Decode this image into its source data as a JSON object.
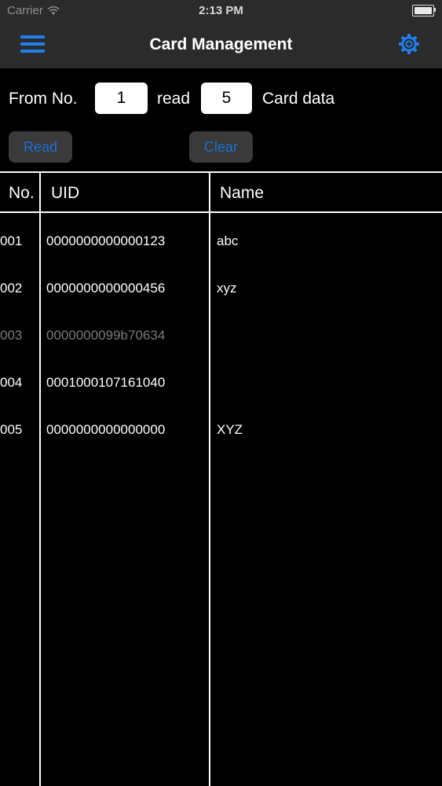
{
  "status_bar": {
    "carrier": "Carrier",
    "time": "2:13 PM",
    "icons": [
      "wifi-icon",
      "battery-icon"
    ]
  },
  "nav": {
    "title": "Card Management",
    "menu_icon": "hamburger-menu-icon",
    "settings_icon": "gear-icon"
  },
  "form": {
    "from_label": "From No.",
    "from_value": "1",
    "read_label": "read",
    "count_value": "5",
    "suffix_label": "Card data"
  },
  "buttons": {
    "read": "Read",
    "clear": "Clear"
  },
  "table": {
    "headers": [
      "No.",
      "UID",
      "Name"
    ],
    "rows": [
      {
        "no": "001",
        "uid": "0000000000000123",
        "name": "abc",
        "dim": false
      },
      {
        "no": "002",
        "uid": "0000000000000456",
        "name": "xyz",
        "dim": false
      },
      {
        "no": "003",
        "uid": "0000000099b70634",
        "name": "",
        "dim": true
      },
      {
        "no": "004",
        "uid": "0001000107161040",
        "name": "",
        "dim": false
      },
      {
        "no": "005",
        "uid": "0000000000000000",
        "name": "XYZ",
        "dim": false
      }
    ]
  },
  "colors": {
    "background": "#000000",
    "bar": "#2b2b2b",
    "accent": "#1d7ff2",
    "button_bg": "#3a3a3a",
    "dim_text": "#7a7a7a"
  }
}
